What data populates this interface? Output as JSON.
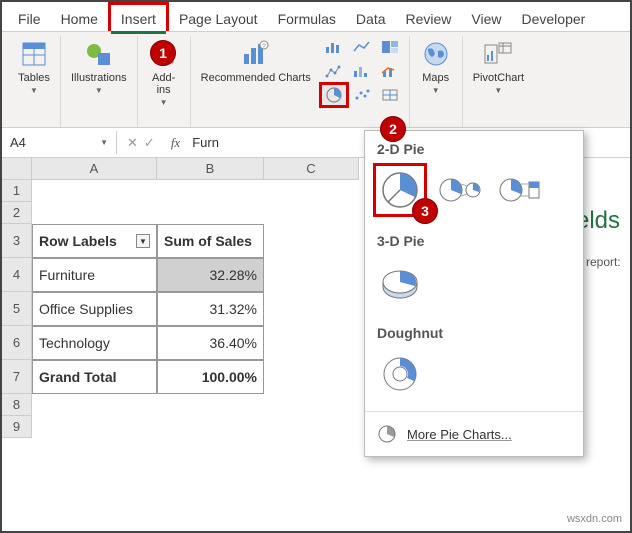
{
  "ribbon": {
    "tabs": [
      "File",
      "Home",
      "Insert",
      "Page Layout",
      "Formulas",
      "Data",
      "Review",
      "View",
      "Developer"
    ],
    "active_tab": "Insert",
    "groups": {
      "tables": "Tables",
      "illustrations": "Illustrations",
      "addins": "Add-ins",
      "rec_charts": "Recommended Charts",
      "maps": "Maps",
      "pivotchart": "PivotChart"
    }
  },
  "formula_bar": {
    "name_box": "A4",
    "formula": "Furn"
  },
  "columns": [
    "A",
    "B",
    "C"
  ],
  "rows": [
    "1",
    "2",
    "3",
    "4",
    "5",
    "6",
    "7",
    "8",
    "9"
  ],
  "pivot": {
    "header_row_labels": "Row Labels",
    "header_sum": "Sum of Sales",
    "rows": [
      {
        "label": "Furniture",
        "val": "32.28%"
      },
      {
        "label": "Office Supplies",
        "val": "31.32%"
      },
      {
        "label": "Technology",
        "val": "36.40%"
      }
    ],
    "total_label": "Grand Total",
    "total_val": "100.00%"
  },
  "pie_menu": {
    "sec_2d": "2-D Pie",
    "sec_3d": "3-D Pie",
    "sec_doughnut": "Doughnut",
    "more": "More Pie Charts..."
  },
  "side_panel": {
    "title_fragment": "elds",
    "sub": "o report:"
  },
  "callouts": {
    "c1": "1",
    "c2": "2",
    "c3": "3"
  },
  "watermark": "wsxdn.com"
}
